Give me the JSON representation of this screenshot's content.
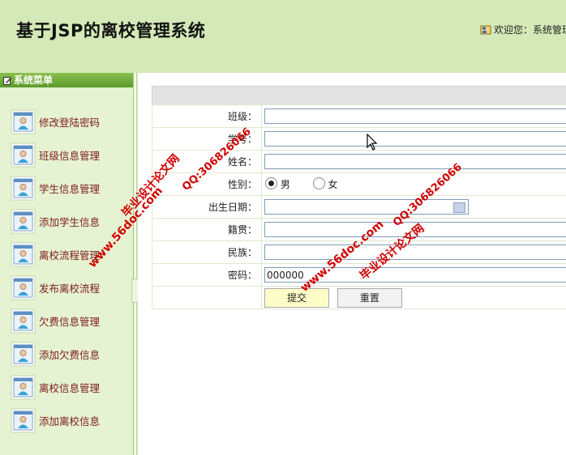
{
  "header": {
    "title": "基于JSP的离校管理系统",
    "welcome": "欢迎您：系统管理"
  },
  "sidebar": {
    "menu_title": "系统菜单",
    "items": [
      {
        "label": "修改登陆密码"
      },
      {
        "label": "班级信息管理"
      },
      {
        "label": "学生信息管理"
      },
      {
        "label": "添加学生信息"
      },
      {
        "label": "离校流程管理"
      },
      {
        "label": "发布离校流程"
      },
      {
        "label": "欠费信息管理"
      },
      {
        "label": "添加欠费信息"
      },
      {
        "label": "离校信息管理"
      },
      {
        "label": "添加离校信息"
      }
    ]
  },
  "form": {
    "fields": {
      "class": {
        "label": "班级：",
        "value": ""
      },
      "student_id": {
        "label": "学号：",
        "value": ""
      },
      "name": {
        "label": "姓名：",
        "value": ""
      },
      "gender": {
        "label": "性别：",
        "options": [
          "男",
          "女"
        ],
        "selected": "男"
      },
      "birthdate": {
        "label": "出生日期：",
        "value": ""
      },
      "native_place": {
        "label": "籍贯：",
        "value": ""
      },
      "ethnicity": {
        "label": "民族：",
        "value": ""
      },
      "password": {
        "label": "密码：",
        "value": "000000"
      }
    },
    "submit_label": "提交",
    "reset_label": "重置"
  },
  "watermarks": {
    "site_name": "毕业设计论文网",
    "url": "www.56doc.com",
    "qq": "QQ:306826066"
  },
  "colors": {
    "header_bg": "#d4e9b7",
    "menu_title_bg": "#6aa834",
    "menu_label": "#7a1a1a",
    "watermark": "#d10000"
  }
}
